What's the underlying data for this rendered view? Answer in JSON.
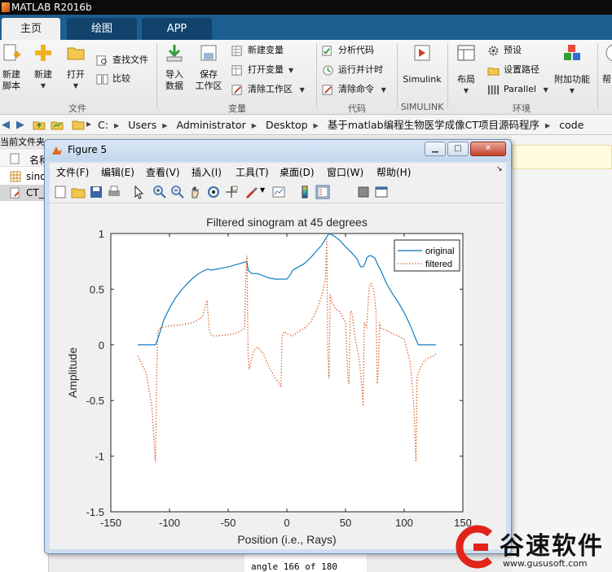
{
  "app": {
    "title": "MATLAB R2016b"
  },
  "tabs": [
    {
      "label": "主页",
      "active": true
    },
    {
      "label": "绘图",
      "active": false
    },
    {
      "label": "APP",
      "active": false
    }
  ],
  "ribbon": {
    "file": {
      "new_script": "新建\n脚本",
      "new": "新建",
      "open": "打开",
      "find_files": "查找文件",
      "compare": "比较",
      "group_label": "文件"
    },
    "variable": {
      "import_data": "导入\n数据",
      "save_workspace": "保存\n工作区",
      "new_variable": "新建变量",
      "open_variable": "打开变量",
      "clear_workspace": "清除工作区",
      "group_label": "变量"
    },
    "code": {
      "analyze_code": "分析代码",
      "run_and_time": "运行并计时",
      "clear_commands": "清除命令",
      "group_label": "代码"
    },
    "simulink": {
      "button": "Simulink",
      "group_label": "SIMULINK"
    },
    "environment": {
      "layout": "布局",
      "preferences": "预设",
      "set_path": "设置路径",
      "parallel": "Parallel",
      "addons": "附加功能",
      "group_label": "环境"
    },
    "resources_partial": "帮"
  },
  "address": {
    "crumbs": [
      "C:",
      "Users",
      "Administrator",
      "Desktop",
      "基于matlab编程生物医学成像CT项目源码程序",
      "code"
    ]
  },
  "left_panel": {
    "header": "当前文件夹",
    "name_col": "名称",
    "items": [
      "sinog",
      "CT_"
    ]
  },
  "command_window": {
    "line": "angle 166 of 180"
  },
  "figure": {
    "title": "Figure 5",
    "menu": [
      "文件(F)",
      "编辑(E)",
      "查看(V)",
      "插入(I)",
      "工具(T)",
      "桌面(D)",
      "窗口(W)",
      "帮助(H)"
    ],
    "toolbar_icons": [
      "new-figure-icon",
      "open-icon",
      "save-icon",
      "print-icon",
      "pointer-icon",
      "zoom-in-icon",
      "zoom-out-icon",
      "pan-icon",
      "rotate-icon",
      "data-cursor-icon",
      "brush-icon",
      "link-plot-icon",
      "colorbar-icon",
      "legend-icon",
      "hide-plot-tools-icon",
      "show-plot-tools-icon"
    ]
  },
  "watermark": {
    "brand": "谷速软件",
    "url": "www.gususoft.com"
  },
  "colors": {
    "original": "#0072bd",
    "filtered": "#d95319",
    "tabstrip": "#1d5e90"
  },
  "chart_data": {
    "type": "line",
    "title": "Filtered sinogram at 45 degrees",
    "xlabel": "Position (i.e., Rays)",
    "ylabel": "Amplitude",
    "xlim": [
      -150,
      150
    ],
    "ylim": [
      -1.5,
      1
    ],
    "xticks": [
      -150,
      -100,
      -50,
      0,
      50,
      100,
      150
    ],
    "yticks": [
      -1.5,
      -1,
      -0.5,
      0,
      0.5,
      1
    ],
    "legend": {
      "position": "top-right",
      "entries": [
        "original",
        "filtered"
      ]
    },
    "series": [
      {
        "name": "original",
        "style": "solid",
        "x": [
          -127,
          -112,
          -110,
          -105,
          -100,
          -95,
          -90,
          -85,
          -80,
          -75,
          -70,
          -67,
          -65,
          -60,
          -50,
          -40,
          -34,
          -33,
          -30,
          -25,
          -20,
          -15,
          -10,
          -5,
          0,
          3,
          5,
          10,
          15,
          20,
          25,
          30,
          34,
          36,
          38,
          40,
          45,
          50,
          55,
          60,
          62,
          63,
          65,
          67,
          68,
          70,
          72,
          75,
          77,
          80,
          85,
          90,
          95,
          100,
          105,
          108,
          110,
          112,
          127
        ],
        "y": [
          0,
          0,
          0.05,
          0.22,
          0.33,
          0.42,
          0.49,
          0.55,
          0.6,
          0.64,
          0.67,
          0.68,
          0.67,
          0.68,
          0.7,
          0.73,
          0.75,
          0.67,
          0.64,
          0.64,
          0.62,
          0.6,
          0.59,
          0.59,
          0.59,
          0.63,
          0.67,
          0.7,
          0.73,
          0.78,
          0.84,
          0.9,
          0.97,
          1.0,
          0.99,
          0.98,
          0.94,
          0.88,
          0.83,
          0.77,
          0.72,
          0.7,
          0.7,
          0.74,
          0.78,
          0.8,
          0.8,
          0.78,
          0.73,
          0.67,
          0.55,
          0.46,
          0.38,
          0.29,
          0.18,
          0.1,
          0.05,
          0,
          0
        ]
      },
      {
        "name": "filtered",
        "style": "dotted",
        "x": [
          -127,
          -120,
          -115,
          -113,
          -112,
          -111,
          -110,
          -108,
          -105,
          -100,
          -90,
          -80,
          -72,
          -68,
          -66,
          -64,
          -60,
          -50,
          -45,
          -40,
          -36,
          -35,
          -34,
          -33,
          -32,
          -30,
          -28,
          -25,
          -20,
          -15,
          -10,
          -6,
          -5,
          -4,
          -2,
          0,
          5,
          10,
          15,
          20,
          25,
          30,
          33,
          34,
          35,
          36,
          37,
          38,
          40,
          42,
          45,
          50,
          52,
          53,
          54,
          55,
          56,
          58,
          62,
          64,
          65,
          66,
          68,
          70,
          71,
          72,
          74,
          76,
          77,
          78,
          79,
          80,
          85,
          90,
          95,
          100,
          105,
          108,
          110,
          111,
          112,
          114,
          117,
          120,
          125,
          127
        ],
        "y": [
          -0.1,
          -0.25,
          -0.55,
          -0.9,
          -1.05,
          -0.3,
          0.12,
          0.15,
          0.16,
          0.17,
          0.18,
          0.2,
          0.25,
          0.4,
          0.12,
          0.08,
          0.08,
          0.09,
          0.1,
          0.12,
          0.15,
          0.6,
          0.8,
          -0.1,
          -0.22,
          -0.12,
          -0.05,
          -0.02,
          -0.08,
          -0.2,
          -0.3,
          -0.35,
          -0.38,
          0.08,
          0.12,
          0.1,
          0.08,
          0.12,
          0.15,
          0.2,
          0.3,
          0.45,
          0.6,
          0.95,
          -0.1,
          -0.3,
          0.45,
          0.4,
          0.35,
          0.32,
          0.3,
          0.2,
          -0.3,
          -0.35,
          0.3,
          0.3,
          0.25,
          0.08,
          -0.15,
          -0.4,
          -0.55,
          0.2,
          0.15,
          0.5,
          0.55,
          0.55,
          0.5,
          0.3,
          -0.35,
          -0.2,
          0.2,
          0.15,
          0.13,
          0.1,
          0.08,
          0.05,
          -0.15,
          -0.5,
          -1.05,
          -0.3,
          -0.25,
          -0.2,
          -0.15,
          -0.12,
          -0.1,
          -0.08
        ]
      }
    ]
  }
}
